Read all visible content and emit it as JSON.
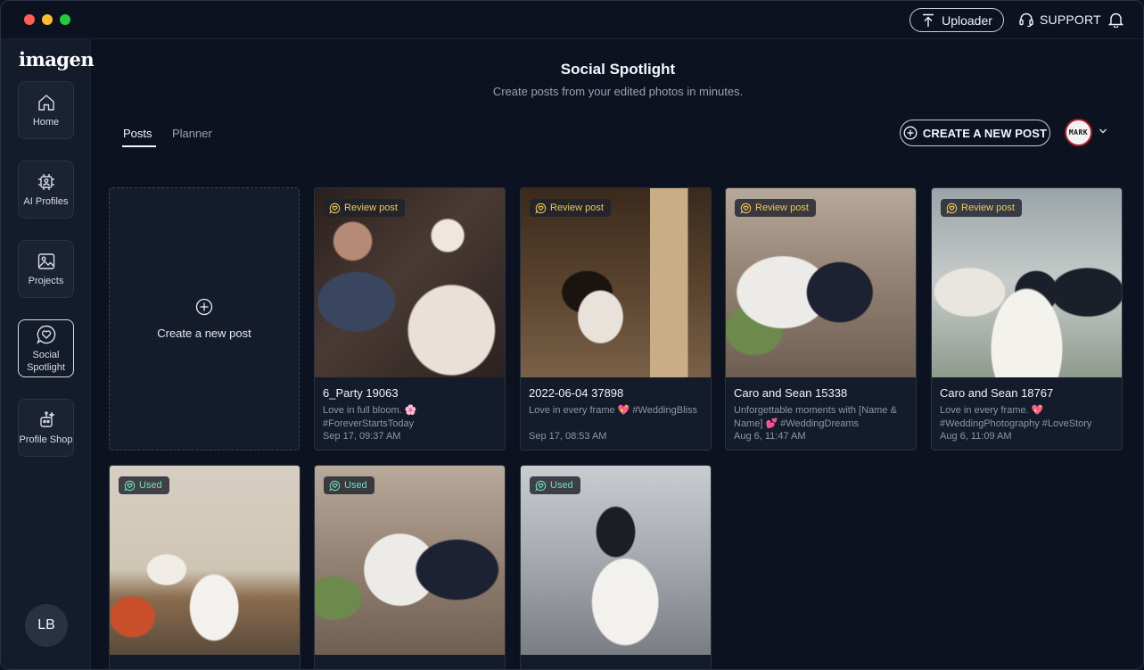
{
  "app": {
    "logo": "imagen",
    "uploader_label": "Uploader",
    "support_label": "SUPPORT",
    "user_initials": "LB"
  },
  "sidebar": {
    "items": [
      {
        "label": "Home",
        "icon": "home-icon"
      },
      {
        "label": "AI Profiles",
        "icon": "ai-chip-icon"
      },
      {
        "label": "Projects",
        "icon": "image-icon"
      },
      {
        "label": "Social Spotlight",
        "icon": "heart-chat-icon",
        "active": true
      },
      {
        "label": "Profile Shop",
        "icon": "shop-icon"
      }
    ]
  },
  "header": {
    "title": "Social Spotlight",
    "subtitle": "Create posts from your edited photos in minutes."
  },
  "tabs": [
    {
      "label": "Posts",
      "active": true
    },
    {
      "label": "Planner",
      "active": false
    }
  ],
  "actions": {
    "create_post_label": "CREATE A NEW POST",
    "brand_avatar_text": "MARK"
  },
  "new_post_card": {
    "label": "Create a new post"
  },
  "posts": [
    {
      "status": "Review post",
      "title": "6_Party 19063",
      "caption": "Love in full bloom. 🌸 #ForeverStartsToday",
      "date": "Sep 17, 09:37 AM"
    },
    {
      "status": "Review post",
      "title": "2022-06-04 37898",
      "caption": "Love in every frame 💖 #WeddingBliss",
      "date": "Sep 17, 08:53 AM"
    },
    {
      "status": "Review post",
      "title": "Caro and Sean 15338",
      "caption": "Unforgettable moments with [Name & Name] 💕 #WeddingDreams",
      "date": "Aug 6, 11:47 AM"
    },
    {
      "status": "Review post",
      "title": "Caro and Sean 18767",
      "caption": "Love in every frame. 💖 #WeddingPhotography #LoveStory",
      "date": "Aug 6, 11:09 AM"
    },
    {
      "status": "Used"
    },
    {
      "status": "Used"
    },
    {
      "status": "Used"
    }
  ],
  "colors": {
    "background": "#0c1220",
    "sidebar": "#141b2a",
    "review_badge": "#f0c75e",
    "used_badge": "#6ee0b4"
  }
}
